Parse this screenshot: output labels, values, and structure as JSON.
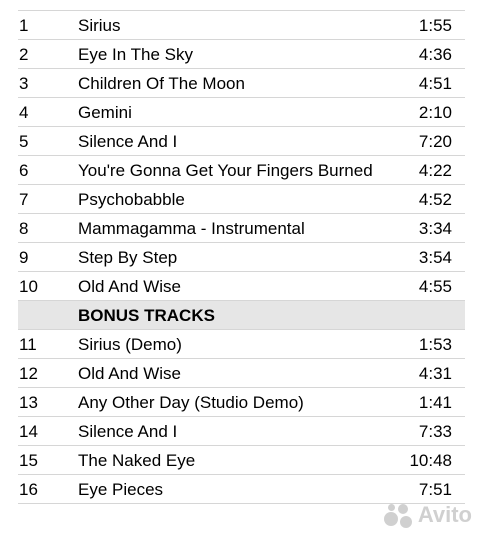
{
  "tracks": [
    {
      "num": "1",
      "title": "Sirius",
      "duration": "1:55"
    },
    {
      "num": "2",
      "title": "Eye In The Sky",
      "duration": "4:36"
    },
    {
      "num": "3",
      "title": "Children Of The Moon",
      "duration": "4:51"
    },
    {
      "num": "4",
      "title": "Gemini",
      "duration": "2:10"
    },
    {
      "num": "5",
      "title": "Silence And I",
      "duration": "7:20"
    },
    {
      "num": "6",
      "title": "You're Gonna Get Your Fingers Burned",
      "duration": "4:22"
    },
    {
      "num": "7",
      "title": "Psychobabble",
      "duration": "4:52"
    },
    {
      "num": "8",
      "title": "Mammagamma - Instrumental",
      "duration": "3:34"
    },
    {
      "num": "9",
      "title": "Step By Step",
      "duration": "3:54"
    },
    {
      "num": "10",
      "title": "Old And Wise",
      "duration": "4:55"
    }
  ],
  "bonus_header": "BONUS TRACKS",
  "bonus_tracks": [
    {
      "num": "11",
      "title": "Sirius (Demo)",
      "duration": "1:53"
    },
    {
      "num": "12",
      "title": "Old And Wise",
      "duration": "4:31"
    },
    {
      "num": "13",
      "title": "Any Other Day (Studio Demo)",
      "duration": "1:41"
    },
    {
      "num": "14",
      "title": "Silence And I",
      "duration": "7:33"
    },
    {
      "num": "15",
      "title": "The Naked Eye",
      "duration": "10:48"
    },
    {
      "num": "16",
      "title": "Eye Pieces",
      "duration": "7:51"
    }
  ],
  "watermark": {
    "text": "Avito",
    "icon": "avito-logo-icon"
  }
}
